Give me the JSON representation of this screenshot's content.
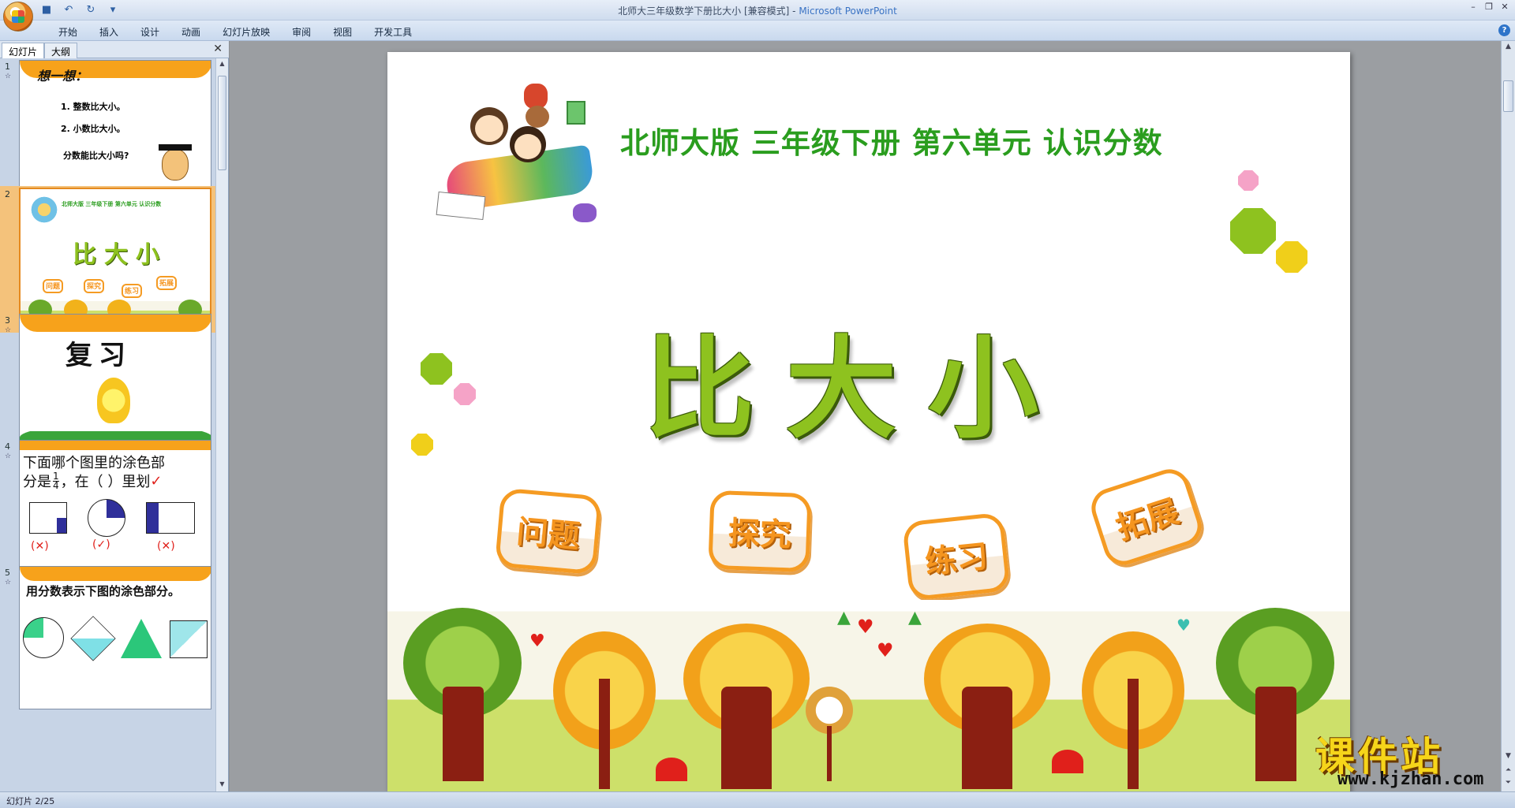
{
  "window": {
    "title": "北师大三年级数学下册比大小 [兼容模式]",
    "title_separator": " - ",
    "app_name": "Microsoft PowerPoint"
  },
  "ribbon": {
    "tabs": [
      "开始",
      "插入",
      "设计",
      "动画",
      "幻灯片放映",
      "审阅",
      "视图",
      "开发工具"
    ]
  },
  "left_pane": {
    "tab_slides": "幻灯片",
    "tab_outline": "大纲",
    "close": "✕",
    "slides": [
      {
        "number": "1",
        "title": "想一想：",
        "line1": "1. 整数比大小。",
        "line2": "2. 小数比大小。",
        "question": "分数能比大小吗?"
      },
      {
        "number": "2",
        "heading": "北师大版  三年级下册  第六单元   认识分数",
        "title": "比大小",
        "buttons": [
          "问题",
          "探究",
          "练习",
          "拓展"
        ]
      },
      {
        "number": "3",
        "title": "复习"
      },
      {
        "number": "4",
        "text_a": "下面哪个图里的涂色部",
        "text_b": "分是",
        "frac_num": "1",
        "frac_den": "4",
        "text_c": "，在（  ）里划",
        "check": "✓",
        "marks": [
          "(✕)",
          "(✓)",
          "(✕)"
        ]
      },
      {
        "number": "5",
        "title": "用分数表示下图的涂色部分。"
      }
    ]
  },
  "slide": {
    "heading": "北师大版  三年级下册  第六单元    认识分数",
    "title": "比大小",
    "buttons": [
      "问题",
      "探究",
      "练习",
      "拓展"
    ]
  },
  "watermark": {
    "big": "课件站",
    "small": "www.kjzhan.com"
  },
  "status": {
    "slide_indicator": "幻灯片 2/25"
  },
  "colors": {
    "heading_green": "#2a9d1e",
    "title_green": "#8ec21f",
    "button_orange": "#f59b23",
    "selected_thumb": "#f4c27b"
  }
}
